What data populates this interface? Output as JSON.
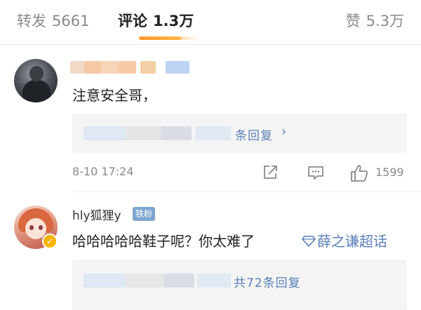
{
  "tabs": {
    "repost": {
      "label": "转发",
      "count": "5661"
    },
    "comment": {
      "label": "评论",
      "count": "1.3万"
    },
    "like": {
      "label": "赞",
      "count": "5.3万"
    }
  },
  "comments": [
    {
      "text": "注意安全哥，",
      "reply_link": "条回复",
      "time": "8-10 17:24",
      "like_count": "1599"
    },
    {
      "username": "hly狐狸y",
      "fan_badge": "铁粉",
      "text": "哈哈哈哈哈鞋子呢？你太难了",
      "supertopic": "薛之谦超话",
      "reply_link": "共72条回复"
    }
  ],
  "colors": {
    "accent": "#ff9a2e",
    "link": "#5a7fb8",
    "fan_badge": "#7fa6cf",
    "verified_badge": "#f7b500"
  },
  "icons": [
    "share-icon",
    "comment-icon",
    "like-icon",
    "supertopic-diamond-icon",
    "verified-badge-icon"
  ]
}
